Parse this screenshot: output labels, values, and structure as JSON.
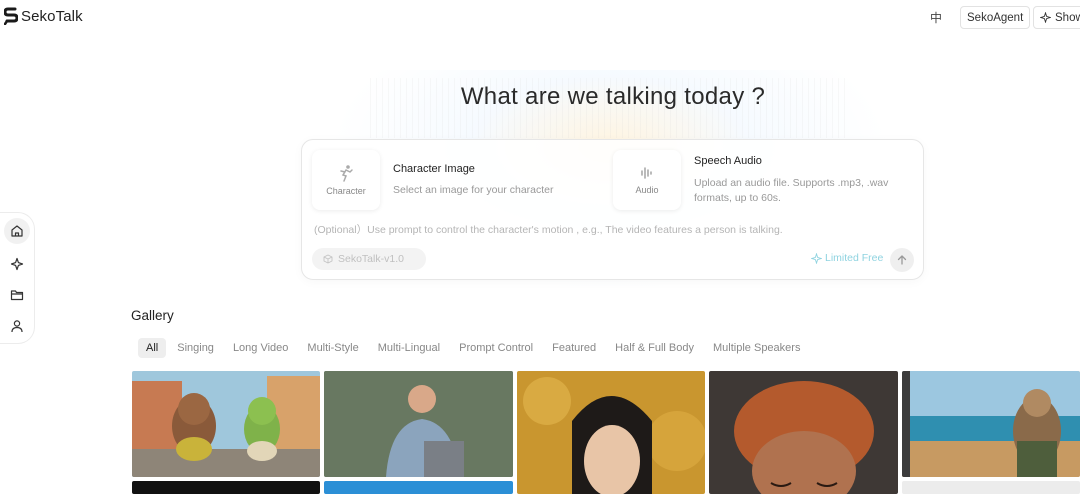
{
  "header": {
    "brand": "SekoTalk",
    "lang_toggle": "中",
    "agent_button": "SekoAgent",
    "show_button": "Show"
  },
  "hero": {
    "title": "What are we talking today ?"
  },
  "composer": {
    "character": {
      "tile_label": "Character",
      "title": "Character Image",
      "description": "Select an image for your character"
    },
    "audio": {
      "tile_label": "Audio",
      "title": "Speech Audio",
      "description": "Upload an audio file. Supports .mp3, .wav formats, up to 60s."
    },
    "prompt_placeholder": "(Optional）Use prompt to control the character's motion , e.g., The video features a person is talking.",
    "model": "SekoTalk-v1.0",
    "limited_label": "Limited Free"
  },
  "sidebar": {
    "items": [
      {
        "icon": "home-icon",
        "active": true
      },
      {
        "icon": "sparkle-icon",
        "active": false
      },
      {
        "icon": "folder-icon",
        "active": false
      },
      {
        "icon": "user-icon",
        "active": false
      }
    ]
  },
  "gallery": {
    "title": "Gallery",
    "tabs": [
      "All",
      "Singing",
      "Long Video",
      "Multi-Style",
      "Multi-Lingual",
      "Prompt Control",
      "Featured",
      "Half & Full Body",
      "Multiple Speakers"
    ],
    "active_tab": "All"
  },
  "colors": {
    "accent_limited": "#8fd3e0",
    "border": "#e6e6e6"
  }
}
